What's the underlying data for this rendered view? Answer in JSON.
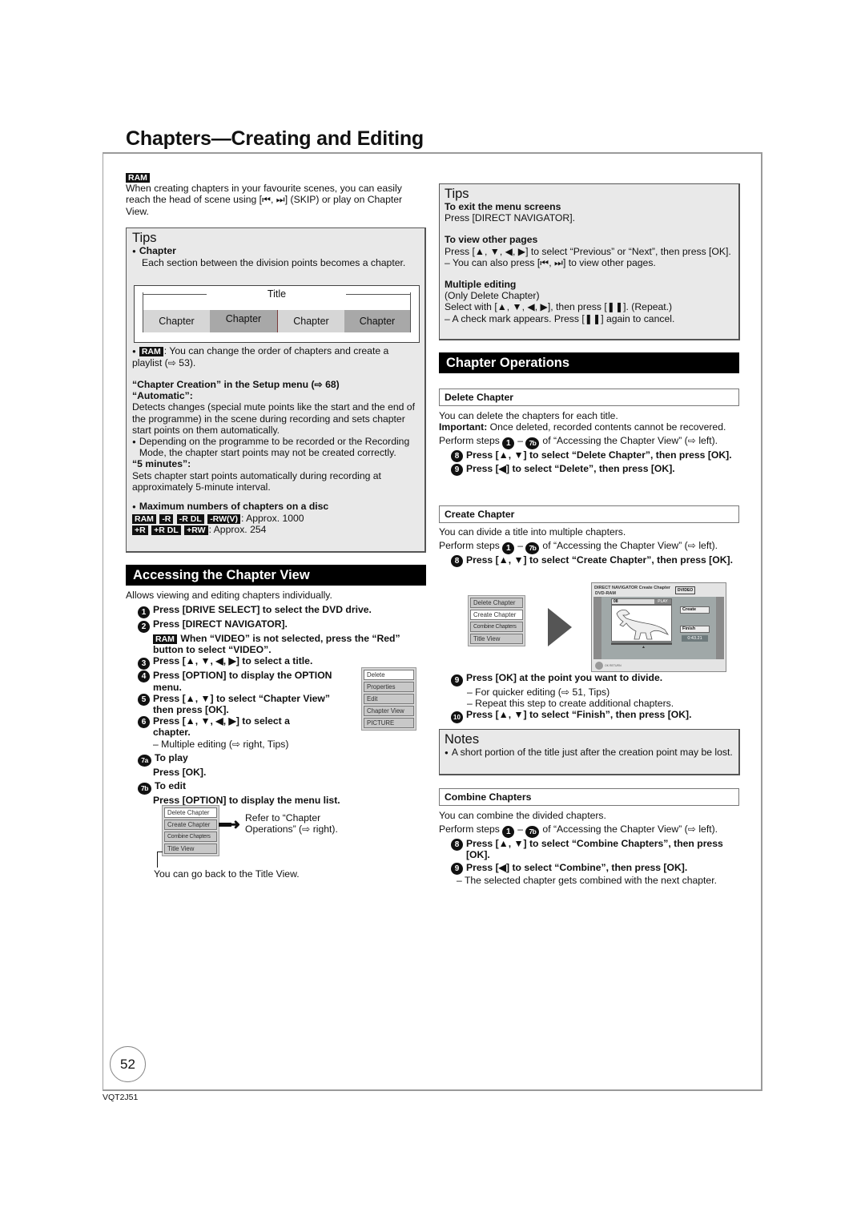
{
  "page": {
    "title": "Chapters—Creating and Editing",
    "page_number": "52",
    "doc_code": "VQT2J51"
  },
  "intro": {
    "badge": "RAM",
    "text": "When creating chapters in your favourite scenes, you can easily reach the head of scene using [⏮, ⏭] (SKIP) or play on Chapter View."
  },
  "tips_left": {
    "header": "Tips",
    "chapter_label": "Chapter",
    "chapter_desc": "Each section between the division points becomes a chapter.",
    "diagram": {
      "title_label": "Title",
      "chapters": [
        "Chapter",
        "Chapter",
        "Chapter",
        "Chapter"
      ]
    },
    "ram_badge": "RAM",
    "ram_text": ": You can change the order of chapters and create a playlist (⇨ 53).",
    "setup_heading": "“Chapter Creation” in the Setup menu (⇨ 68)",
    "automatic_label": "“Automatic”:",
    "automatic_desc": "Detects changes (special mute points like the start and the end of the programme) in the scene during recording and sets chapter start points on them automatically.",
    "automatic_note": "Depending on the programme to be recorded or the Recording Mode, the chapter start points may not be created correctly.",
    "five_min_label": "“5 minutes”:",
    "five_min_desc": "Sets chapter start points automatically during recording at approximately 5-minute interval.",
    "max_heading": "Maximum numbers of chapters on a disc",
    "max_row1_badges": [
      "RAM",
      "-R",
      "-R DL",
      "-RW(V)"
    ],
    "max_row1_value": ": Approx. 1000",
    "max_row2_badges": [
      "+R",
      "+R DL",
      "+RW"
    ],
    "max_row2_value": ": Approx. 254"
  },
  "accessing": {
    "heading": "Accessing the Chapter View",
    "intro": "Allows viewing and editing chapters individually.",
    "steps": [
      {
        "num": "1",
        "text": "Press [DRIVE SELECT] to select the DVD drive."
      },
      {
        "num": "2",
        "text": "Press [DIRECT NAVIGATOR]."
      },
      {
        "num": "3",
        "text": "Press [▲, ▼, ◀, ▶] to select a title."
      },
      {
        "num": "4",
        "text": "Press [OPTION] to display the OPTION menu."
      },
      {
        "num": "5",
        "text": "Press [▲, ▼] to select “Chapter View” then press [OK]."
      },
      {
        "num": "6",
        "text": "Press [▲, ▼, ◀, ▶] to select a chapter."
      },
      {
        "num": "7a",
        "text": "To play"
      },
      {
        "num": "7b",
        "text": "To edit"
      }
    ],
    "step2_badge": "RAM",
    "step2_note": "When “VIDEO” is not selected, press the “Red” button to select “VIDEO”.",
    "step6_note": "– Multiple editing (⇨ right, Tips)",
    "step7a_sub": "Press [OK].",
    "step7b_sub": "Press [OPTION] to display the menu list.",
    "option_menu": [
      "Delete",
      "Properties",
      "Edit",
      "Chapter View",
      "PICTURE"
    ],
    "edit_menu": [
      "Delete Chapter",
      "Create Chapter",
      "Combine Chapters",
      "Title View"
    ],
    "edit_menu_ref": "Refer to “Chapter Operations” (⇨ right).",
    "title_view_note": "You can go back to the Title View."
  },
  "tips_right": {
    "header": "Tips",
    "exit_heading": "To exit the menu screens",
    "exit_text": "Press [DIRECT NAVIGATOR].",
    "pages_heading": "To view other pages",
    "pages_text": "Press [▲, ▼, ◀, ▶] to select “Previous” or “Next”, then press [OK].",
    "pages_note": "–  You can also press [⏮, ⏭] to view other pages.",
    "multi_heading": "Multiple editing",
    "multi_sub": "(Only Delete Chapter)",
    "multi_text": "Select with [▲, ▼, ◀, ▶], then press [❚❚]. (Repeat.)",
    "multi_note": "–  A check mark appears. Press [❚❚] again to cancel."
  },
  "operations": {
    "heading": "Chapter Operations",
    "perform_prefix": "Perform steps",
    "perform_suffix": "of “Accessing the Chapter View” (⇨ left).",
    "perform_from": "1",
    "perform_to": "7b",
    "delete": {
      "title": "Delete Chapter",
      "desc": "You can delete the chapters for each title.",
      "important_label": "Important:",
      "important_text": "Once deleted, recorded contents cannot be recovered.",
      "step8": "Press [▲, ▼] to select “Delete Chapter”, then press [OK].",
      "step9": "Press [◀] to select “Delete”, then press [OK]."
    },
    "create": {
      "title": "Create Chapter",
      "desc": "You can divide a title into multiple chapters.",
      "step8": "Press [▲, ▼] to select “Create Chapter”, then press [OK].",
      "step9": "Press [OK] at the point you want to divide.",
      "step9_notes": [
        "– For quicker editing (⇨ 51, Tips)",
        "– Repeat this step to create additional chapters."
      ],
      "step10": "Press [▲, ▼] to select “Finish”, then press [OK].",
      "menu": [
        "Delete Chapter",
        "Create Chapter",
        "Combine Chapters",
        "Title View"
      ],
      "screen": {
        "header": "DIRECT NAVIGATOR   Create Chapter",
        "disc": "DVD-RAM",
        "mode": "DVIDEO",
        "chapter_no": "08",
        "play_label": "PLAY",
        "create_btn": "Create",
        "finish_btn": "Finish",
        "time": "0:43.21",
        "footer": "OK RETURN"
      }
    },
    "notes": {
      "header": "Notes",
      "text": "A short portion of the title just after the creation point may be lost."
    },
    "combine": {
      "title": "Combine Chapters",
      "desc": "You can combine the divided chapters.",
      "step8": "Press [▲, ▼] to select “Combine Chapters”, then press [OK].",
      "step9": "Press [◀] to select “Combine”, then press [OK].",
      "step9_note": "– The selected chapter gets combined with the next chapter."
    }
  }
}
